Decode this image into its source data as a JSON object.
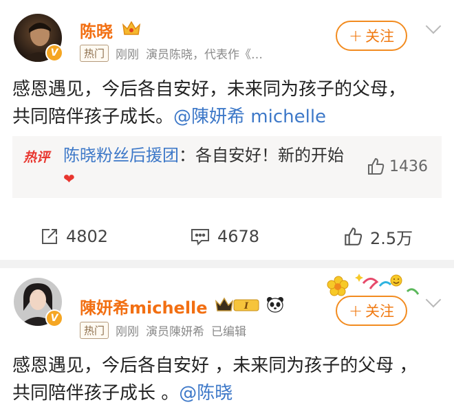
{
  "post1": {
    "author": "陈晓",
    "tag": "热门",
    "time": "刚刚",
    "bio": "演员陈晓，代表作《…",
    "follow_label": "关注",
    "follow_plus": "+",
    "content_line1": "感恩遇见，今后各自安好，未来同为孩子的父母，",
    "content_line2": "共同陪伴孩子成长。",
    "mention": "@陳妍希 michelle",
    "hot_comment": {
      "label": "热评",
      "user": "陈晓粉丝后援团",
      "text": "：各自安好！新的开始",
      "heart": "❤",
      "likes": "1436"
    },
    "actions": {
      "repost": "4802",
      "comment": "4678",
      "like": "2.5万"
    }
  },
  "post2": {
    "author": "陳妍希michelle",
    "level": "I",
    "tag": "热门",
    "time": "刚刚",
    "bio": "演员陳妍希",
    "edited": "已编辑",
    "follow_label": "关注",
    "follow_plus": "+",
    "content_line1": "感恩遇见，今后各自安好 ，未来同为孩子的父母 ，",
    "content_line2": "共同陪伴孩子成长 。",
    "mention": "@陈晓"
  },
  "colors": {
    "name": "#f26f12",
    "mention": "#3d78c8",
    "follow": "#f07a12",
    "hot": "#e8362f"
  },
  "icons": [
    "crown-icon",
    "verified-badge-icon",
    "chevron-down-icon",
    "repost-icon",
    "comment-icon",
    "like-icon",
    "panda-icon",
    "flower-decoration-icon"
  ]
}
